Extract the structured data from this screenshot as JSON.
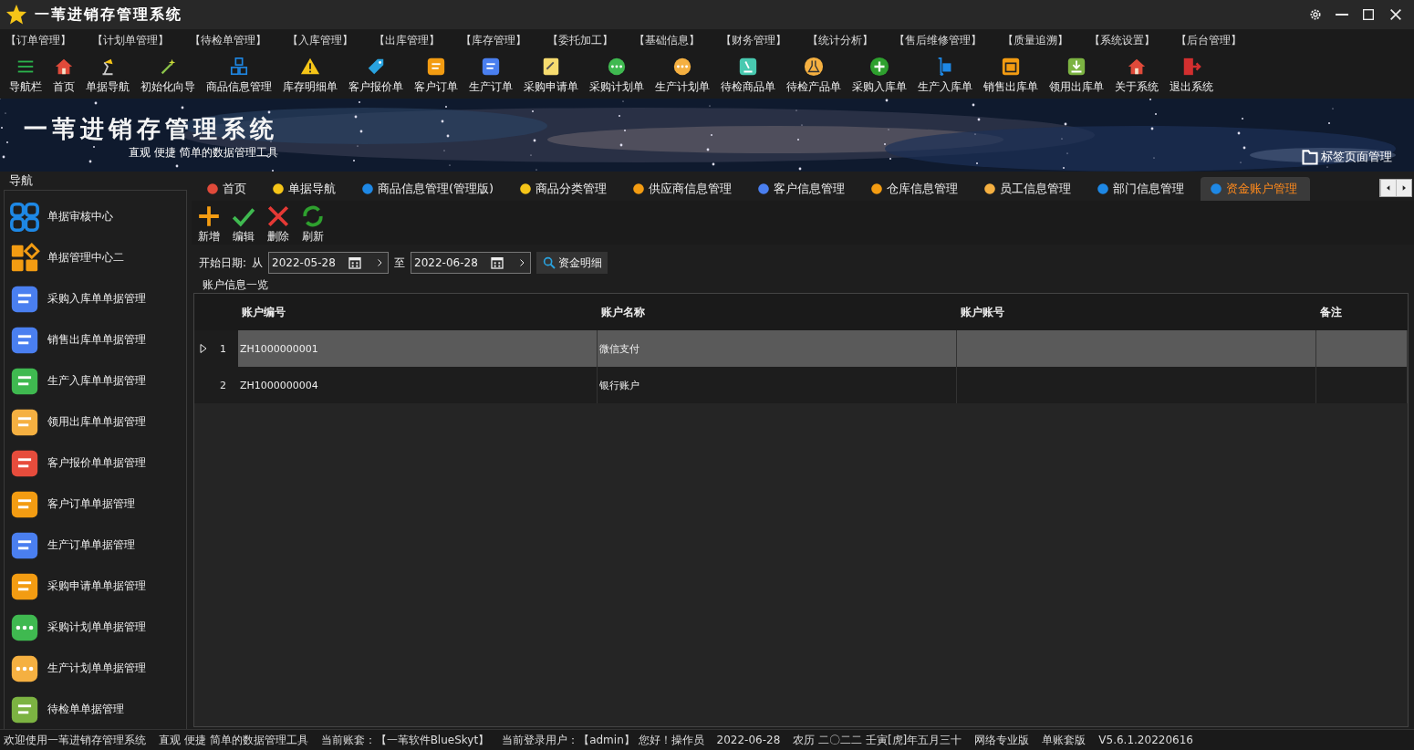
{
  "window": {
    "title": "一苇进销存管理系统"
  },
  "menu": [
    "【订单管理】",
    "【计划单管理】",
    "【待检单管理】",
    "【入库管理】",
    "【出库管理】",
    "【库存管理】",
    "【委托加工】",
    "【基础信息】",
    "【财务管理】",
    "【统计分析】",
    "【售后维修管理】",
    "【质量追溯】",
    "【系统设置】",
    "【后台管理】"
  ],
  "toolbar": [
    "导航栏",
    "首页",
    "单据导航",
    "初始化向导",
    "商品信息管理",
    "库存明细单",
    "客户报价单",
    "客户订单",
    "生产订单",
    "采购申请单",
    "采购计划单",
    "生产计划单",
    "待检商品单",
    "待检产品单",
    "采购入库单",
    "生产入库单",
    "销售出库单",
    "领用出库单",
    "关于系统",
    "退出系统"
  ],
  "banner": {
    "title": "一苇进销存管理系统",
    "subtitle": "直观 便捷 简单的数据管理工具",
    "tab_manager": "标签页面管理"
  },
  "sidebar": {
    "title": "导航",
    "items": [
      "单据审核中心",
      "单据管理中心二",
      "采购入库单单据管理",
      "销售出库单单据管理",
      "生产入库单单据管理",
      "领用出库单单据管理",
      "客户报价单单据管理",
      "客户订单单据管理",
      "生产订单单据管理",
      "采购申请单单据管理",
      "采购计划单单据管理",
      "生产计划单单据管理",
      "待检单单据管理"
    ]
  },
  "tabs": [
    {
      "label": "首页",
      "selected": false
    },
    {
      "label": "单据导航",
      "selected": false
    },
    {
      "label": "商品信息管理(管理版)",
      "selected": false
    },
    {
      "label": "商品分类管理",
      "selected": false
    },
    {
      "label": "供应商信息管理",
      "selected": false
    },
    {
      "label": "客户信息管理",
      "selected": false
    },
    {
      "label": "仓库信息管理",
      "selected": false
    },
    {
      "label": "员工信息管理",
      "selected": false
    },
    {
      "label": "部门信息管理",
      "selected": false
    },
    {
      "label": "资金账户管理",
      "selected": true
    }
  ],
  "actions": [
    "新增",
    "编辑",
    "删除",
    "刷新"
  ],
  "filter": {
    "label": "开始日期:",
    "from": "从",
    "start": "2022-05-28",
    "to": "至",
    "end": "2022-06-28",
    "button": "资金明细"
  },
  "group_title": "账户信息一览",
  "table": {
    "columns": [
      "账户编号",
      "账户名称",
      "账户账号",
      "备注"
    ],
    "rows": [
      {
        "index": "1",
        "cells": [
          "ZH1000000001",
          "微信支付"
        ],
        "selected": true
      },
      {
        "index": "2",
        "cells": [
          "ZH1000000004",
          "银行账户"
        ],
        "selected": false
      }
    ]
  },
  "status_bar": [
    "欢迎使用一苇进销存管理系统",
    "直观 便捷 简单的数据管理工具",
    "当前账套：【一苇软件BlueSkyt】",
    "当前登录用户：【admin】 您好！操作员",
    "2022-06-28",
    "农历 二〇二二 壬寅[虎]年五月三十",
    "网络专业版",
    "单账套版",
    "V5.6.1.20220616"
  ]
}
